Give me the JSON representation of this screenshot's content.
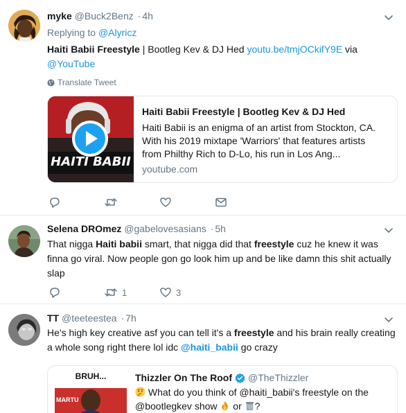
{
  "tweets": [
    {
      "name": "myke",
      "handle": "@Buck2Benz",
      "time": "4h",
      "replying_prefix": "Replying to",
      "replying_to": "@Alyricz",
      "text_bold": "Haiti Babii Freestyle",
      "text_rest": " | Bootleg Kev & DJ Hed ",
      "link": "youtu.be/tmjOCkifY9E",
      "text_via": " via",
      "mention": "@YouTube",
      "translate": "Translate Tweet",
      "card": {
        "thumb_text": "HAITI BABII",
        "title": "Haiti Babii Freestyle | Bootleg Kev & DJ Hed",
        "description": "Haiti Babii is an enigma of an artist from Stockton, CA. With his 2019 mixtape 'Warriors' that features artists from Philthy Rich to D-Lo, his run in Los Ang...",
        "domain": "youtube.com"
      },
      "actions": {
        "reply": "",
        "retweet": "",
        "like": ""
      }
    },
    {
      "name": "Selena DROmez",
      "handle": "@gabelovesasians",
      "time": "5h",
      "segments": [
        "That nigga ",
        "Haiti babii",
        " smart, that nigga did that ",
        "freestyle",
        " cuz he knew it was finna go viral. Now people gon go look him up and be like damn this shit actually slap"
      ],
      "actions": {
        "reply": "",
        "retweet": "1",
        "like": "3"
      }
    },
    {
      "name": "TT",
      "handle": "@teeteestea",
      "time": "7h",
      "segments": [
        "He's high key creative asf you can tell it's a ",
        "freestyle",
        " and his brain really creating a whole song right there lol idc ",
        "@haiti_babii",
        " go crazy"
      ],
      "quote": {
        "thumb_text": "BRUH...",
        "thumb_sub": "MARTU",
        "name": "Thizzler On The Roof",
        "handle": "@TheThizzler",
        "text_a": " What do you think of @haiti_babii's freestyle on the @bootlegkev show ",
        "text_b": " or ",
        "text_c": "?"
      }
    }
  ],
  "colors": {
    "text": "#14171a",
    "secondary": "#657786",
    "link": "#1b95e0",
    "border": "#e1e8ed",
    "verified": "#1da1f2"
  },
  "icons": [
    "caret-down-icon",
    "globe-icon",
    "play-icon",
    "reply-icon",
    "retweet-icon",
    "like-icon",
    "message-icon",
    "verified-icon",
    "thinking-emoji",
    "fire-emoji",
    "trash-emoji"
  ]
}
